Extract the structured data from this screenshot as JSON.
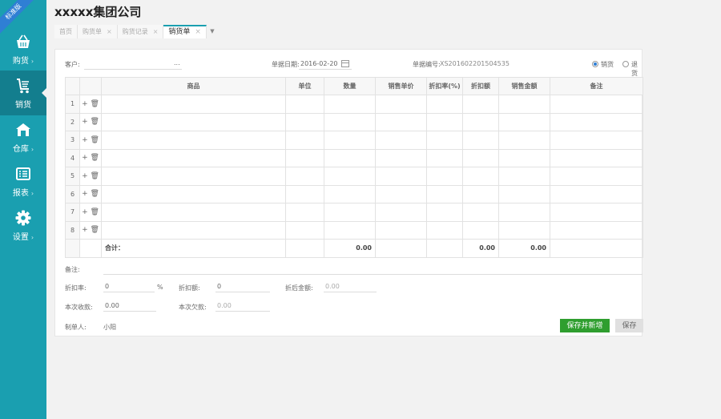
{
  "brand": {
    "edition_ribbon": "标准版",
    "company": "xxxxx集团公司"
  },
  "sidebar": {
    "items": [
      {
        "label": "购货",
        "icon": "basket-icon"
      },
      {
        "label": "销货",
        "icon": "cart-icon"
      },
      {
        "label": "仓库",
        "icon": "warehouse-icon"
      },
      {
        "label": "报表",
        "icon": "report-icon"
      },
      {
        "label": "设置",
        "icon": "gear-icon"
      }
    ],
    "chevron": "›"
  },
  "tabs": [
    {
      "label": "首页"
    },
    {
      "label": "购货单",
      "close": "×"
    },
    {
      "label": "购货记录",
      "close": "×"
    },
    {
      "label": "销货单",
      "close": "×"
    }
  ],
  "tab_more": "▼",
  "form": {
    "customer_label": "客户:",
    "customer_value": "",
    "customer_more": "...",
    "date_label": "单据日期:",
    "date_value": "2016-02-20",
    "doc_no_label": "单据编号:",
    "doc_no_value": "XS201602201504535",
    "radio_sale": "销货",
    "radio_return": "退货"
  },
  "table": {
    "headers": [
      "",
      "",
      "商品",
      "单位",
      "数量",
      "销售单价",
      "折扣率(%)",
      "折扣额",
      "销售金额",
      "备注"
    ],
    "row_numbers": [
      "1",
      "2",
      "3",
      "4",
      "5",
      "6",
      "7",
      "8"
    ],
    "row_ops": "+ 🗑",
    "total_label": "合计：",
    "total_qty": "0.00",
    "total_discount": "0.00",
    "total_amount": "0.00"
  },
  "footer": {
    "remark_label": "备注:",
    "discount_rate_label": "折扣率:",
    "discount_rate_value": "0",
    "percent": "%",
    "discount_amount_label": "折扣额:",
    "discount_amount_value": "0",
    "after_discount_label": "折后金额:",
    "after_discount_value": "0.00",
    "received_label": "本次收款:",
    "received_value": "0.00",
    "owed_label": "本次欠款:",
    "owed_value": "0.00",
    "maker_label": "制单人:",
    "maker_value": "小阳",
    "save_new": "保存并新增",
    "save": "保存"
  },
  "colors": {
    "sidebar": "#1a9fb0",
    "sidebar_active": "#137e8e",
    "primary_button": "#2f9e2f",
    "ribbon": "#2f7fd4"
  }
}
